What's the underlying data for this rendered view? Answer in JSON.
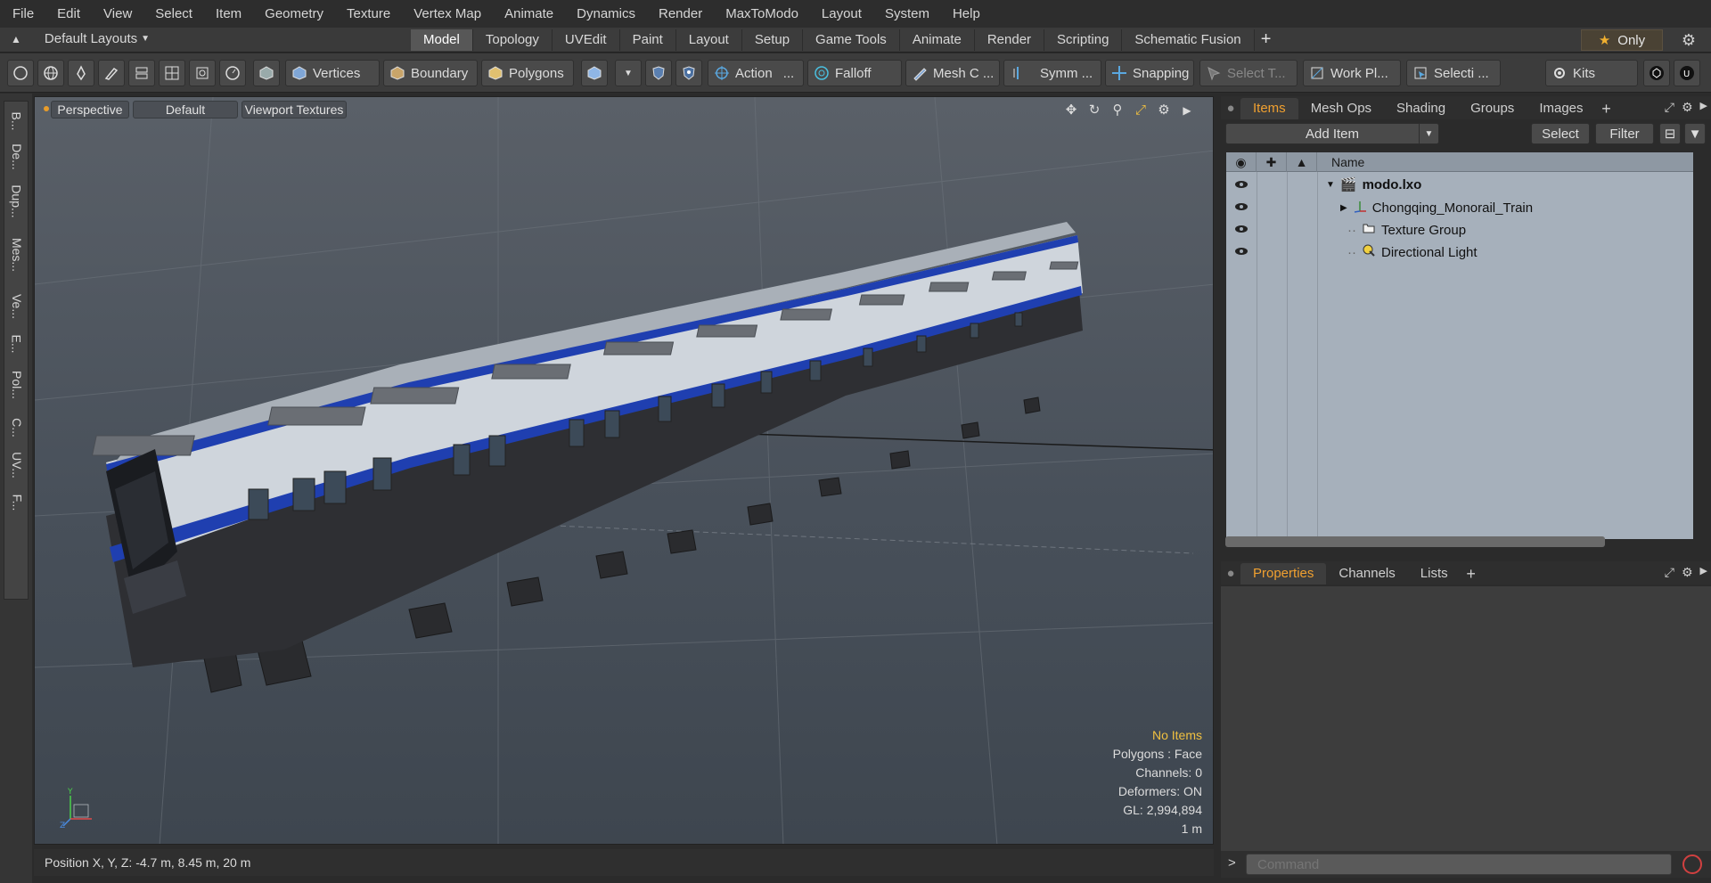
{
  "menu": [
    "File",
    "Edit",
    "View",
    "Select",
    "Item",
    "Geometry",
    "Texture",
    "Vertex Map",
    "Animate",
    "Dynamics",
    "Render",
    "MaxToModo",
    "Layout",
    "System",
    "Help"
  ],
  "layouts_label": "Default Layouts",
  "tabs": [
    "Model",
    "Topology",
    "UVEdit",
    "Paint",
    "Layout",
    "Setup",
    "Game Tools",
    "Animate",
    "Render",
    "Scripting",
    "Schematic Fusion"
  ],
  "only_label": "Only",
  "toolbar": {
    "vertices": "Vertices",
    "boundary": "Boundary",
    "polygons": "Polygons",
    "action": "Action",
    "falloff": "Falloff",
    "mesh": "Mesh C ...",
    "symm": "Symm ...",
    "snapping": "Snapping",
    "select_t": "Select T...",
    "work_pl": "Work Pl...",
    "selecti": "Selecti ...",
    "kits": "Kits"
  },
  "left_tabs": [
    "B...",
    "De...",
    "Dup...",
    "Mes...",
    "Ve...",
    "E...",
    "Pol...",
    "C...",
    "UV...",
    "F..."
  ],
  "viewport": {
    "perspective": "Perspective",
    "default": "Default",
    "textures": "Viewport Textures",
    "info": {
      "no_items": "No Items",
      "polygons": "Polygons : Face",
      "channels": "Channels: 0",
      "deformers": "Deformers: ON",
      "gl": "GL: 2,994,894",
      "scale": "1 m"
    }
  },
  "position": "Position X, Y, Z:   -4.7 m, 8.45 m, 20 m",
  "items_panel": {
    "tabs": [
      "Items",
      "Mesh Ops",
      "Shading",
      "Groups",
      "Images"
    ],
    "add_item": "Add Item",
    "select": "Select",
    "filter": "Filter",
    "col_name": "Name",
    "rows": [
      {
        "name": "modo.lxo"
      },
      {
        "name": "Chongqing_Monorail_Train"
      },
      {
        "name": "Texture Group"
      },
      {
        "name": "Directional Light"
      }
    ]
  },
  "props_panel": {
    "tabs": [
      "Properties",
      "Channels",
      "Lists"
    ]
  },
  "command_placeholder": "Command",
  "colors": {
    "accent": "#f0a030",
    "train_blue": "#1f3fb0",
    "train_white": "#d8dde2"
  }
}
